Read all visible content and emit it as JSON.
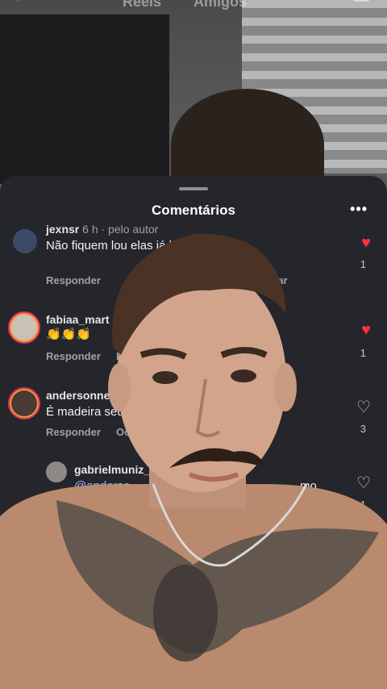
{
  "topbar": {
    "tab_reels": "Reels",
    "tab_friends": "Amigos",
    "back_icon": "chevron-left-icon",
    "camera_icon": "camera-icon"
  },
  "sheet": {
    "title": "Comentários",
    "more_icon": "more-dots-icon"
  },
  "comments": [
    {
      "user": "jexnsr",
      "meta": "6 h · pelo autor",
      "text": "Não fiquem lou  elas já levaram reis a",
      "reply": "Responder",
      "action": "tar",
      "liked": true,
      "likes": "1"
    },
    {
      "user": "fabiaa_mart",
      "text": "👏👏👏",
      "reply": "Responder",
      "action": "R",
      "liked": true,
      "likes": "1"
    },
    {
      "user": "andersonneiff",
      "text": "É madeira seu",
      "reply": "Responder",
      "action": "Ocu",
      "liked": false,
      "likes": "3"
    },
    {
      "user": "gabrielmuniz_",
      "mention": "@anderso",
      "text_tail": "mo",
      "liked": false,
      "likes": "1"
    }
  ],
  "colors": {
    "sheet_bg": "#25262b",
    "like_red": "#ff3040",
    "mention": "#9fb7ff"
  }
}
